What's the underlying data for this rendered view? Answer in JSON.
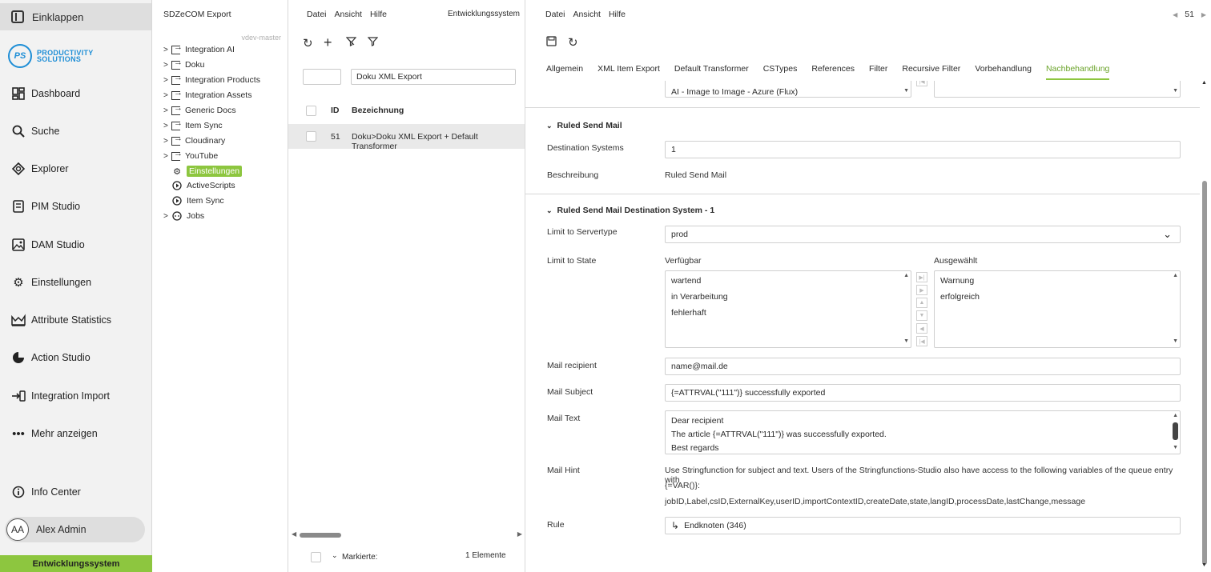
{
  "nav": {
    "collapse_label": "Einklappen",
    "logo": {
      "badge": "PS",
      "line1": "PRODUCTIVITY",
      "line2": "SOLUTIONS"
    },
    "items": [
      {
        "label": "Dashboard",
        "icon": "dashboard-icon"
      },
      {
        "label": "Suche",
        "icon": "search-icon"
      },
      {
        "label": "Explorer",
        "icon": "explorer-icon"
      },
      {
        "label": "PIM Studio",
        "icon": "pim-icon"
      },
      {
        "label": "DAM Studio",
        "icon": "image-icon"
      },
      {
        "label": "Einstellungen",
        "icon": "gear-icon"
      },
      {
        "label": "Attribute Statistics",
        "icon": "chart-icon"
      },
      {
        "label": "Action Studio",
        "icon": "action-icon"
      },
      {
        "label": "Integration Import",
        "icon": "import-icon"
      },
      {
        "label": "Mehr anzeigen",
        "icon": "more-icon"
      }
    ],
    "info_center": "Info Center",
    "user": {
      "initials": "AA",
      "name": "Alex Admin"
    },
    "environment": "Entwicklungssystem"
  },
  "tree": {
    "title": "SDZeCOM Export",
    "branch": "vdev-master",
    "nodes": [
      {
        "label": "Integration AI"
      },
      {
        "label": "Doku"
      },
      {
        "label": "Integration Products"
      },
      {
        "label": "Integration Assets"
      },
      {
        "label": "Generic Docs"
      },
      {
        "label": "Item Sync"
      },
      {
        "label": "Cloudinary"
      },
      {
        "label": "YouTube"
      },
      {
        "label": "Einstellungen"
      },
      {
        "label": "ActiveScripts"
      },
      {
        "label": "Item Sync"
      },
      {
        "label": "Jobs"
      }
    ]
  },
  "list": {
    "menu": [
      "Datei",
      "Ansicht",
      "Hilfe"
    ],
    "environment": "Entwicklungssystem",
    "filter_id": "",
    "filter_name": "Doku XML Export",
    "col_id": "ID",
    "col_name": "Bezeichnung",
    "rows": [
      {
        "id": "51",
        "name": "Doku>Doku XML Export + Default Transformer"
      }
    ],
    "footer_marked": "Markierte:",
    "footer_count": "1 Elemente"
  },
  "detail": {
    "menu": [
      "Datei",
      "Ansicht",
      "Hilfe"
    ],
    "pager": "51",
    "tabs": [
      "Allgemein",
      "XML Item Export",
      "Default Transformer",
      "CSTypes",
      "References",
      "Filter",
      "Recursive Filter",
      "Vorbehandlung",
      "Nachbehandlung"
    ],
    "active_tab": "Nachbehandlung",
    "top_partial_item": "AI - Image to Image - Azure (Flux)",
    "section1": {
      "title": "Ruled Send Mail",
      "dest_label": "Destination Systems",
      "dest_value": "1",
      "desc_label": "Beschreibung",
      "desc_value": "Ruled Send Mail"
    },
    "section2": {
      "title": "Ruled Send Mail Destination System - 1",
      "servertype_label": "Limit to Servertype",
      "servertype_value": "prod",
      "state_label": "Limit to State",
      "available_header": "Verfügbar",
      "selected_header": "Ausgewählt",
      "available": [
        "wartend",
        "in Verarbeitung",
        "fehlerhaft"
      ],
      "selected": [
        "Warnung",
        "erfolgreich"
      ],
      "recipient_label": "Mail recipient",
      "recipient_value": "name@mail.de",
      "subject_label": "Mail Subject",
      "subject_value": "{=ATTRVAL(\"111\")} successfully exported",
      "text_label": "Mail Text",
      "text_lines": [
        "Dear recipient",
        "The article {=ATTRVAL(\"111\")} was successfully exported.",
        "Best regards"
      ],
      "hint_label": "Mail Hint",
      "hint_line1": "Use Stringfunction for subject and text. Users of the Stringfunctions-Studio also have access to the following variables of the queue entry with",
      "hint_line2": "{=VAR()}:",
      "hint_line3": "jobID,Label,csID,ExternalKey,userID,importContextID,createDate,state,langID,processDate,lastChange,message",
      "rule_label": "Rule",
      "rule_value": "Endknoten (346)"
    }
  },
  "colors": {
    "accent": "#8dc63f",
    "brand_blue": "#1e8ed6"
  }
}
